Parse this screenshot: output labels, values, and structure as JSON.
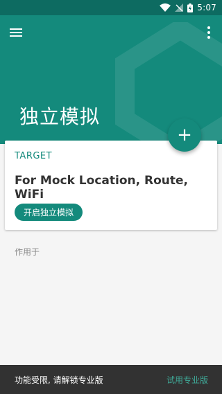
{
  "status_bar": {
    "time": "5:07"
  },
  "header": {
    "title": "独立模拟"
  },
  "fab": {
    "label": "+"
  },
  "card": {
    "target_label": "TARGET",
    "description": "For Mock Location, Route, WiFi",
    "start_button": "开启独立模拟"
  },
  "section": {
    "applies_to": "作用于"
  },
  "snackbar": {
    "message": "功能受限, 请解锁专业版",
    "action": "试用专业版"
  },
  "colors": {
    "primary": "#148a7c",
    "status_bar": "#0d6b61",
    "accent": "#3fa796",
    "snackbar_bg": "#323232"
  }
}
